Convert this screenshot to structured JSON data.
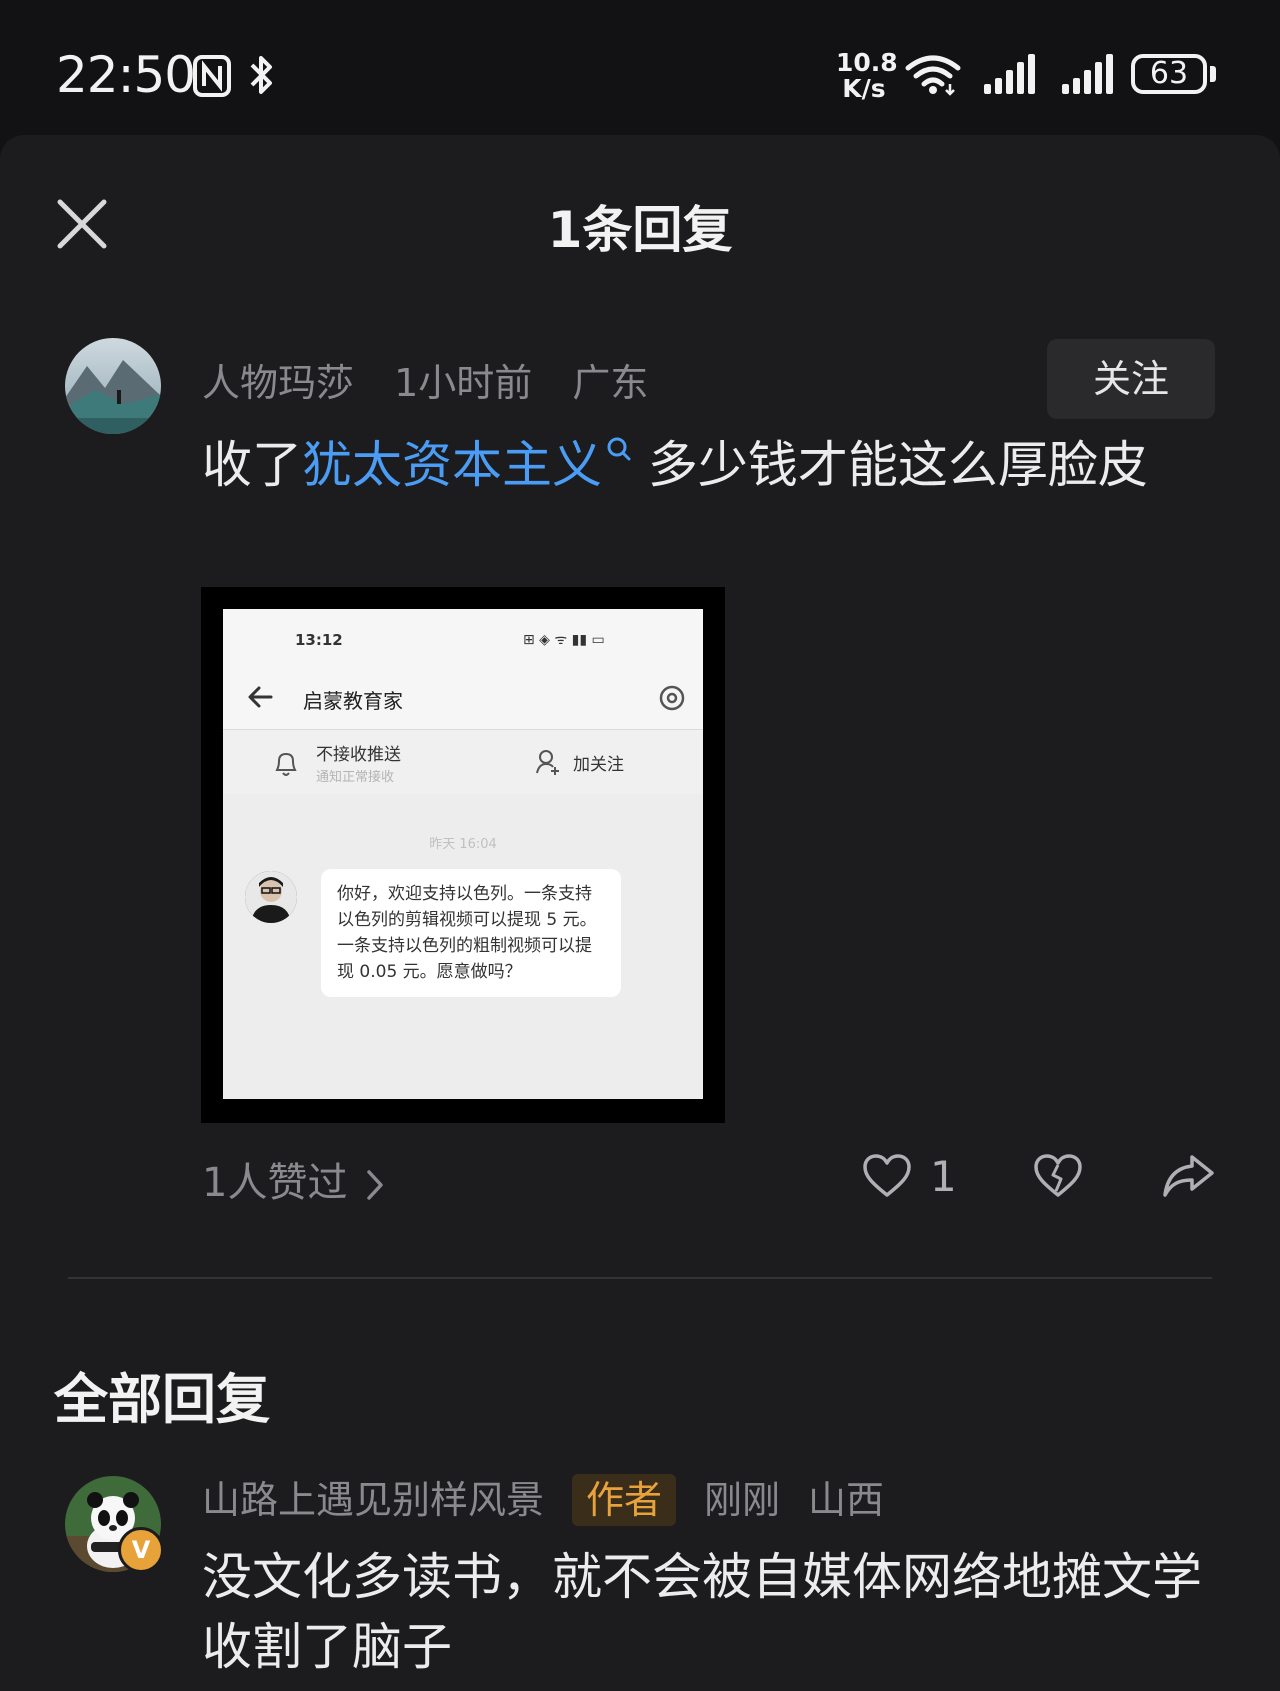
{
  "status_bar": {
    "time": "22:50",
    "net_speed_value": "10.8",
    "net_speed_unit": "K/s",
    "battery": "63",
    "icons": [
      "nfc-icon",
      "bluetooth-icon",
      "wifi-icon",
      "signal-icon",
      "signal-icon",
      "battery-icon"
    ]
  },
  "sheet": {
    "title": "1条回复"
  },
  "main_comment": {
    "username": "人物玛莎",
    "time": "1小时前",
    "location": "广东",
    "follow_label": "关注",
    "text_before": "收了",
    "link_text": "犹太资本主义",
    "text_after": " 多少钱才能这么厚脸皮",
    "likers_text": "1人赞过",
    "like_count": "1"
  },
  "embedded_screenshot": {
    "time": "13:12",
    "status_icons": "⊞ ◈ ᯤ ▮▮ ▭",
    "title": "启蒙教育家",
    "notify_label": "不接收推送",
    "notify_sub": "通知正常接收",
    "follow_label": "加关注",
    "chat_time": "昨天 16:04",
    "message": "你好，欢迎支持以色列。一条支持以色列的剪辑视频可以提现 5 元。一条支持以色列的粗制视频可以提现 0.05 元。愿意做吗？"
  },
  "replies_section": {
    "title": "全部回复",
    "reply": {
      "username": "山路上遇见别样风景",
      "author_badge": "作者",
      "time": "刚刚",
      "location": "山西",
      "verified": "V",
      "text": "没文化多读书，就不会被自媒体网络地摊文学收割了脑子"
    }
  },
  "colors": {
    "background": "#121214",
    "sheet": "#1c1c1e",
    "link": "#4a9cf5",
    "author_badge": "#e6a23c",
    "muted_text": "#8a8a8e"
  }
}
